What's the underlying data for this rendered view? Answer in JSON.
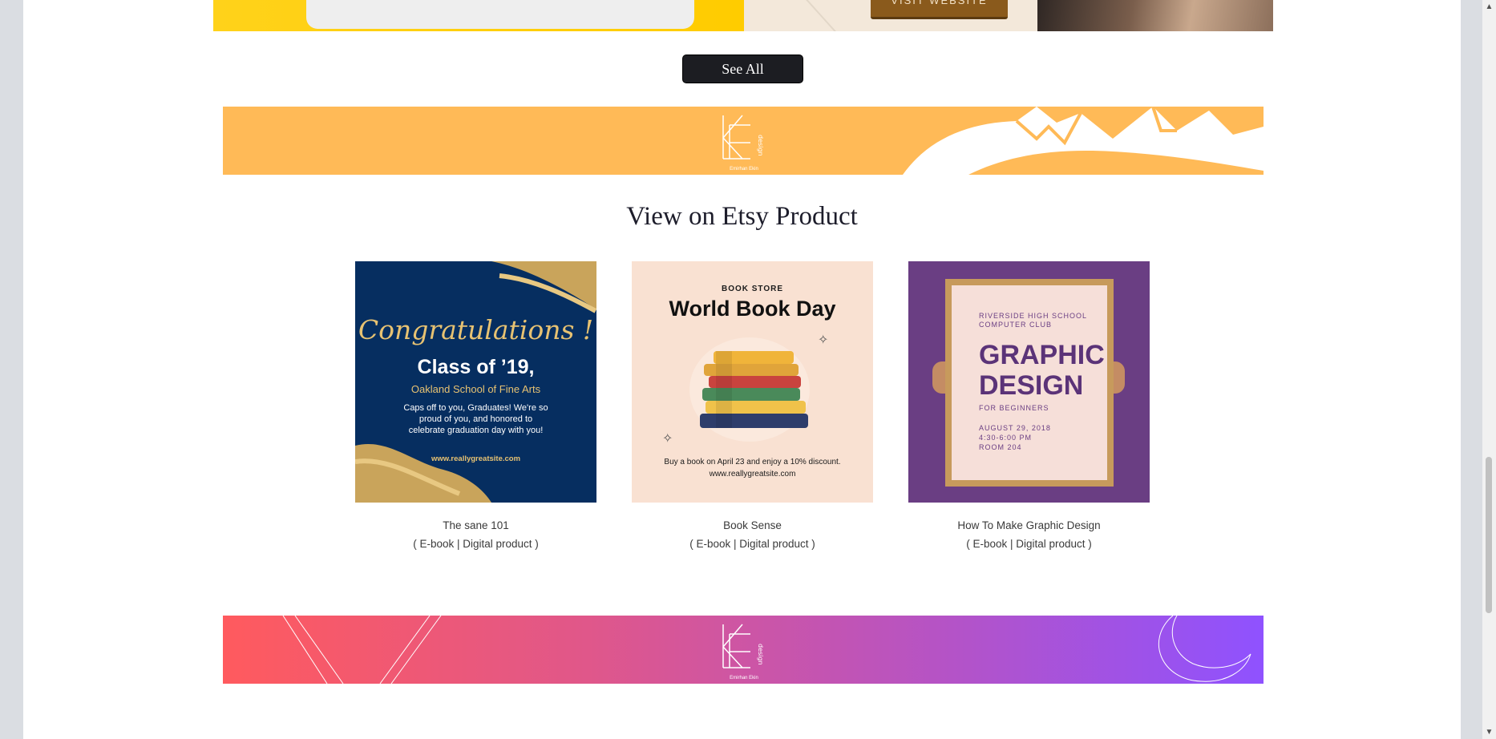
{
  "hero": {
    "visit_label": "VISIT WEBSITE"
  },
  "see_all": {
    "label": "See All"
  },
  "banner": {
    "logo_monogram": "KE",
    "logo_side": "design",
    "logo_name": "Emirhan Ekin"
  },
  "section": {
    "title": "View on Etsy Product"
  },
  "products": [
    {
      "title": "The sane 101",
      "type": "( E-book | Digital product )",
      "art": {
        "script": "Congratulations !",
        "headline": "Class of ’19,",
        "school": "Oakland School of Fine Arts",
        "body": "Caps off to you, Graduates! We're so proud of you, and honored to celebrate graduation day with you!",
        "site": "www.reallygreatsite.com"
      }
    },
    {
      "title": "Book Sense",
      "type": "( E-book | Digital product )",
      "art": {
        "kicker": "BOOK STORE",
        "headline": "World Book Day",
        "foot_line1": "Buy a book on April 23 and enjoy a 10% discount.",
        "foot_line2": "www.reallygreatsite.com"
      }
    },
    {
      "title": "How To Make Graphic Design",
      "type": "( E-book | Digital product )",
      "art": {
        "kicker_line1": "RIVERSIDE HIGH SCHOOL",
        "kicker_line2": "COMPUTER CLUB",
        "headline_line1": "GRAPHIC",
        "headline_line2": "DESIGN",
        "sub": "FOR BEGINNERS",
        "date_line1": "AUGUST 29, 2018",
        "date_line2": "4:30-6:00 PM",
        "date_line3": "ROOM 204"
      }
    }
  ],
  "scrollbar": {
    "up_icon": "▲",
    "down_icon": "▼"
  }
}
